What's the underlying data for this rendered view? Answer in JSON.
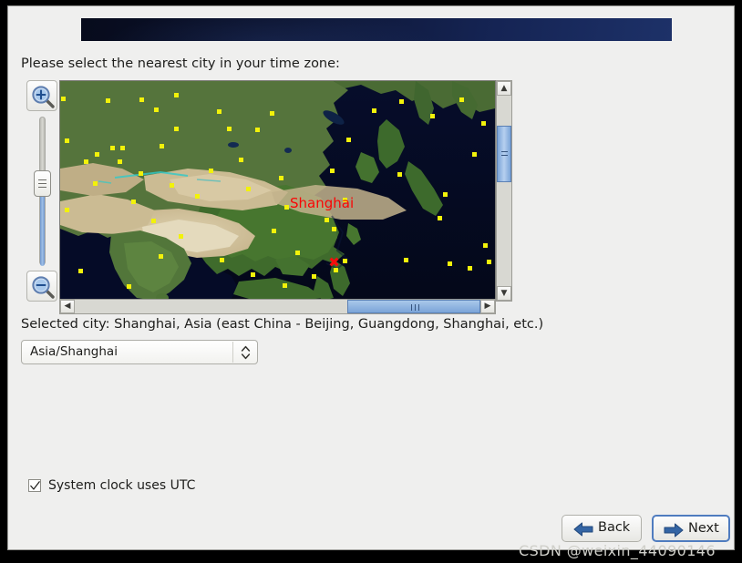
{
  "window": {
    "banner_title": "",
    "background_color": "#efefee",
    "banner_color": "#152454"
  },
  "instruction": {
    "text": "Please select the nearest city in your time zone:"
  },
  "map": {
    "selected_city_marker": "✖",
    "selected_city_label": "Shanghai",
    "marker_color": "#fa0505",
    "zoom_in_icon": "zoom-in-magnifier-icon",
    "zoom_out_icon": "zoom-out-magnifier-icon",
    "slider_name": "map-zoom-slider",
    "vscroll_up_glyph": "▲",
    "vscroll_down_glyph": "▼",
    "hscroll_left_glyph": "◀",
    "hscroll_right_glyph": "▶"
  },
  "selection": {
    "selected_city_text": "Selected city: Shanghai, Asia (east China - Beijing, Guangdong, Shanghai, etc.)",
    "timezone_value": "Asia/Shanghai",
    "timezone_arrows": "▴▾",
    "timezone_options": [
      "Asia/Shanghai"
    ]
  },
  "options": {
    "utc_label": "System clock uses UTC",
    "utc_checked": true
  },
  "navigation": {
    "back_label": "Back",
    "next_label": "Next",
    "accent_color": "#3465a4"
  },
  "watermark": {
    "text": "CSDN @weixin_44090146"
  }
}
